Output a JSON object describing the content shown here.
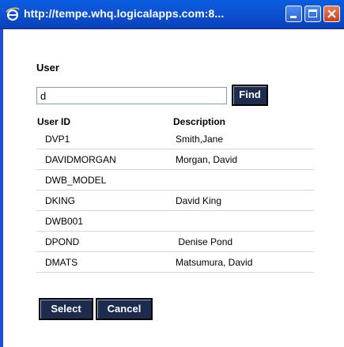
{
  "window": {
    "title": "http://tempe.whq.logicalapps.com:8..."
  },
  "form": {
    "heading": "User",
    "search_value": "d",
    "find_label": "Find"
  },
  "table": {
    "headers": {
      "user_id": "User ID",
      "description": "Description"
    },
    "rows": [
      {
        "user_id": "DVP1",
        "description": "Smith,Jane"
      },
      {
        "user_id": "DAVIDMORGAN",
        "description": "Morgan, David"
      },
      {
        "user_id": "DWB_MODEL",
        "description": ""
      },
      {
        "user_id": "DKING",
        "description": "David King"
      },
      {
        "user_id": "DWB001",
        "description": ""
      },
      {
        "user_id": "DPOND",
        "description": " Denise Pond"
      },
      {
        "user_id": "DMATS",
        "description": "Matsumura, David"
      }
    ]
  },
  "actions": {
    "select_label": "Select",
    "cancel_label": "Cancel"
  },
  "colors": {
    "titlebar": "#0d4fd0",
    "button_bg": "#1d2b4f"
  }
}
